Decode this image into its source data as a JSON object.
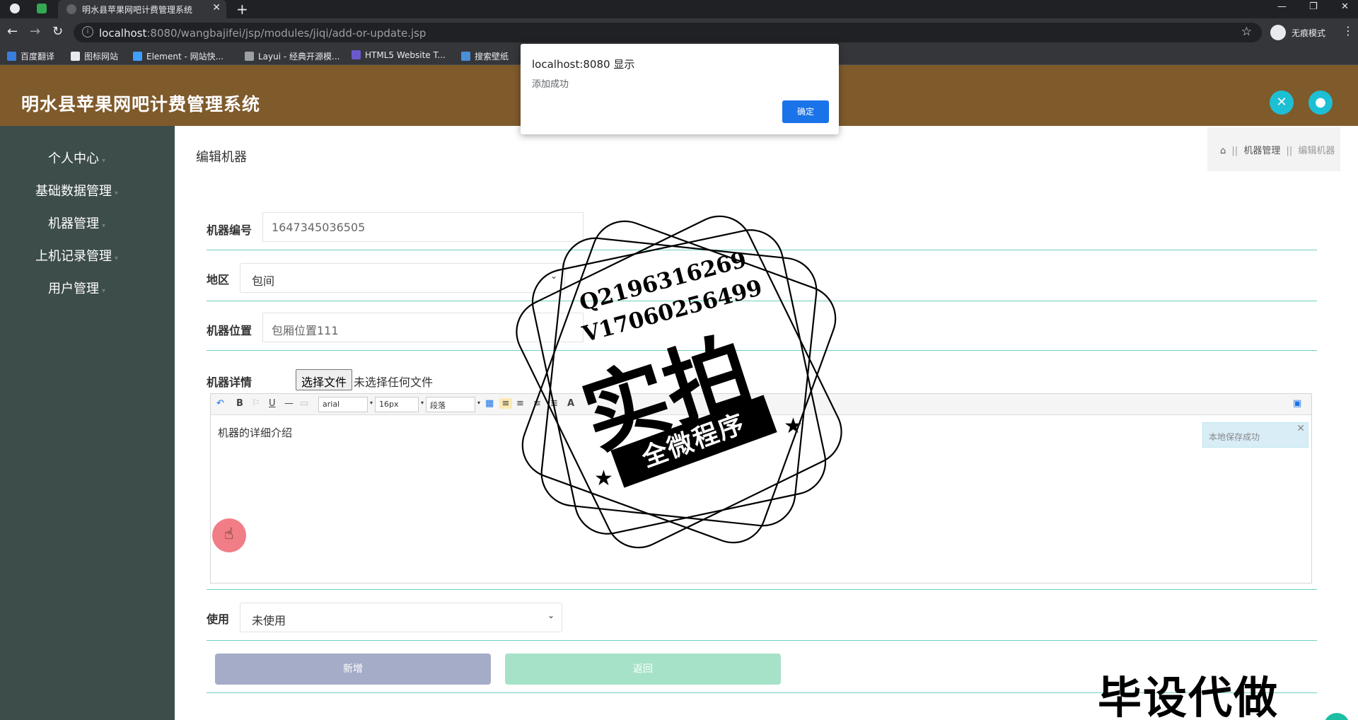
{
  "browser": {
    "tab_title": "明水县苹果网吧计费管理系统",
    "url_host": "localhost",
    "url_path": ":8080/wangbajifei/jsp/modules/jiqi/add-or-update.jsp",
    "incognito_label": "无痕模式",
    "bookmarks": [
      "百度翻译",
      "图标网站",
      "Element - 网站快...",
      "Layui - 经典开源模...",
      "HTML5 Website T...",
      "搜索壁纸"
    ]
  },
  "dialog": {
    "title": "localhost:8080 显示",
    "message": "添加成功",
    "ok_label": "确定"
  },
  "header": {
    "title": "明水县苹果网吧计费管理系统"
  },
  "sidebar": {
    "items": [
      {
        "label": "个人中心"
      },
      {
        "label": "基础数据管理"
      },
      {
        "label": "机器管理"
      },
      {
        "label": "上机记录管理"
      },
      {
        "label": "用户管理"
      }
    ]
  },
  "page": {
    "heading": "编辑机器",
    "breadcrumb": [
      "机器管理",
      "编辑机器"
    ],
    "breadcrumb_sep": "||"
  },
  "form": {
    "machine_no_label": "机器编号",
    "machine_no_value": "1647345036505",
    "region_label": "地区",
    "region_value": "包间",
    "location_label": "机器位置",
    "location_value": "包厢位置111",
    "detail_label": "机器详情",
    "file_button": "选择文件",
    "file_status": "未选择任何文件",
    "editor_font": "arial",
    "editor_size": "16px",
    "editor_block": "段落",
    "editor_content": "机器的详细介绍",
    "editor_toast": "本地保存成功",
    "usage_label": "使用",
    "usage_value": "未使用",
    "submit_label": "新增",
    "back_label": "返回"
  },
  "watermark": {
    "qq": "Q2196316269",
    "vx": "V17060256499",
    "big": "实拍",
    "banner": "全微程序",
    "corner": "毕设代做"
  },
  "colors": {
    "header_bg": "#7f5a2b",
    "sidebar_bg": "#3d4d4a",
    "divider": "#6fd0bf",
    "submit_bg": "#a4acc8",
    "back_bg": "#a6e2c8",
    "accent": "#1dbfd4"
  }
}
